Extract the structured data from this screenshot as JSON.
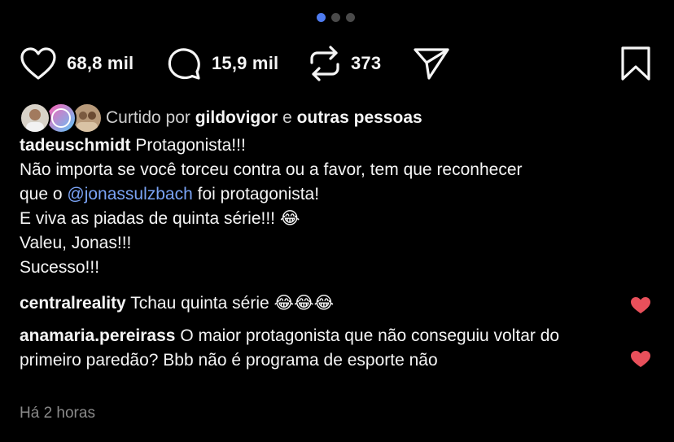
{
  "carousel": {
    "active_index": 0,
    "total": 3
  },
  "actions": {
    "like_count": "68,8 mil",
    "comment_count": "15,9 mil",
    "repost_count": "373",
    "icons": [
      "heart-icon",
      "comment-icon",
      "repost-icon",
      "send-icon",
      "bookmark-icon"
    ]
  },
  "liked_by": {
    "prefix": "Curtido por",
    "user": "gildovigor",
    "connector": "e",
    "others": "outras pessoas"
  },
  "caption": {
    "username": "tadeuschmidt",
    "first_line": "Protagonista!!!",
    "line2": "Não importa se você torceu contra ou a favor, tem que reconhecer",
    "line3_before": "que o ",
    "mention": "@jonassulzbach",
    "line3_after": " foi protagonista!",
    "line4": "E viva as piadas de quinta série!!! 😂",
    "line5": "Valeu, Jonas!!!",
    "line6": "Sucesso!!!"
  },
  "comments": [
    {
      "username": "centralreality",
      "text": "Tchau quinta série 😂😂😂",
      "liked": true
    },
    {
      "username": "anamaria.pereirass",
      "text": "O maior protagonista que não conseguiu voltar do primeiro paredão?  Bbb não é programa de esporte não",
      "liked": true
    }
  ],
  "timestamp": "Há 2 horas",
  "colors": {
    "background": "#000000",
    "heart_red": "#e8505b",
    "mention_blue": "#7aa3f5",
    "active_dot": "#4f7cf0"
  }
}
